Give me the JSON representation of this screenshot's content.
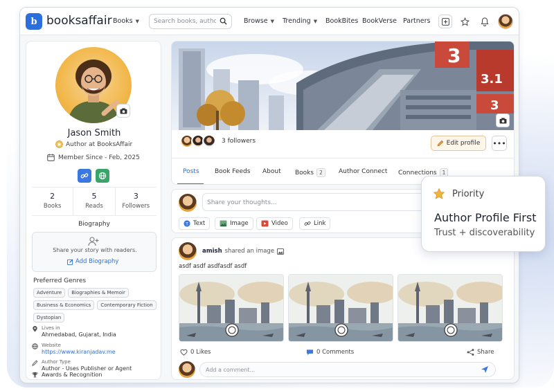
{
  "brand": {
    "logo_mark": "b",
    "name": "booksaffair"
  },
  "nav": {
    "books": "Books",
    "search_placeholder": "Search books, authors...",
    "browse": "Browse",
    "trending": "Trending",
    "bookbites": "BookBites",
    "bookverse": "BookVerse",
    "partners": "Partners"
  },
  "profile": {
    "name": "Jason Smith",
    "role": "Author at BooksAffair",
    "member_since": "Member Since - Feb, 2025",
    "stats": [
      {
        "value": "2",
        "label": "Books"
      },
      {
        "value": "5",
        "label": "Reads"
      },
      {
        "value": "3",
        "label": "Followers"
      }
    ],
    "biography_title": "Biography",
    "biography_prompt": "Share your story with readers.",
    "add_biography": "Add Biography",
    "genres_title": "Preferred Genres",
    "genres": [
      "Adventure",
      "Biographies & Memoir",
      "Business & Economics",
      "Contemporary Fiction",
      "Dystopian"
    ],
    "lives_label": "Lives in",
    "lives_value": "Ahmedabad, Gujarat, India",
    "website_label": "Website",
    "website_value": "https://www.kiranjadav.me",
    "author_type_label": "Author Type",
    "author_type_value": "Author - Uses Publisher or Agent",
    "awards": "Awards & Recognition"
  },
  "cover": {
    "followers_text": "3 followers",
    "edit_profile": "Edit profile",
    "more": "•••",
    "tower_sign_1": "3",
    "tower_sign_2": "3.1",
    "tower_sign_3": "3"
  },
  "tabs": [
    {
      "label": "Posts"
    },
    {
      "label": "Book Feeds"
    },
    {
      "label": "About"
    },
    {
      "label": "Books",
      "count": "2"
    },
    {
      "label": "Author Connect"
    },
    {
      "label": "Connections",
      "count": "1"
    }
  ],
  "composer": {
    "placeholder": "Share your thoughts...",
    "actions": [
      "Text",
      "Image",
      "Video",
      "Link"
    ]
  },
  "post": {
    "author": "amish",
    "action": "shared an image",
    "body": "asdf asdf asdfasdf asdf",
    "likes": "0 Likes",
    "comments": "0 Comments",
    "share": "Share",
    "comment_placeholder": "Add a comment..."
  },
  "callout": {
    "kicker": "Priority",
    "title": "Author Profile First",
    "subtitle": "Trust + discoverability"
  },
  "colors": {
    "accent": "#2a6fdb",
    "avatar_bg": "#f2b84b",
    "edit_btn_bg": "#fff6ea",
    "star": "#f2b33a"
  }
}
